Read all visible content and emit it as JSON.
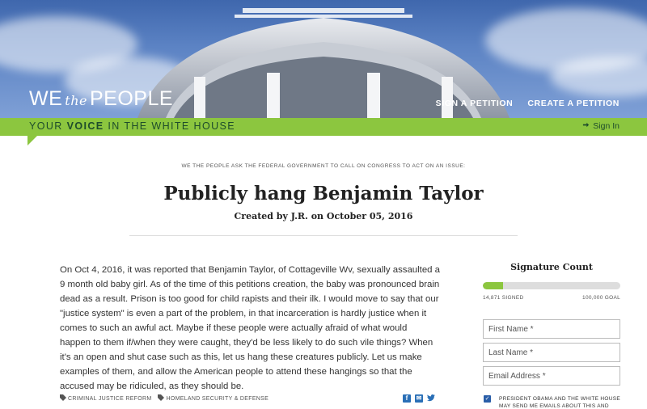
{
  "header": {
    "logo_we": "WE",
    "logo_the": "the",
    "logo_people": "PEOPLE",
    "nav": [
      {
        "label": "SIGN A PETITION"
      },
      {
        "label": "CREATE A PETITION"
      }
    ],
    "tagline_pre": "YOUR ",
    "tagline_bold": "VOICE",
    "tagline_post": " IN THE WHITE HOUSE",
    "signin_icon": "sign-in-icon",
    "signin_label": "Sign In",
    "colors": {
      "accent_green": "#8cc63f",
      "dark_green": "#1e4d2b",
      "link_blue": "#2a6fb6"
    }
  },
  "petition": {
    "intro": "WE THE PEOPLE ASK THE FEDERAL GOVERNMENT TO CALL ON CONGRESS TO ACT ON AN ISSUE:",
    "title": "Publicly hang Benjamin Taylor",
    "created": "Created by J.R. on October 05, 2016",
    "body": "On Oct 4, 2016, it was reported that Benjamin Taylor, of Cottageville Wv, sexually assaulted a 9 month old baby girl. As of the time of this petitions creation, the baby was pronounced brain dead as a result. Prison is too good for child rapists and their ilk. I would move to say that our \"justice system\" is even a part of the problem, in that incarceration is hardly justice when it comes to such an awful act. Maybe if these people were actually afraid of what would happen to them if/when they were caught, they'd be less likely to do such vile things? When it's an open and shut case such as this, let us hang these creatures publicly. Let us make examples of them, and allow the American people to attend these hangings so that the accused may be ridiculed, as they should be.",
    "tags": [
      {
        "icon": "tag-icon",
        "label": "CRIMINAL JUSTICE REFORM"
      },
      {
        "icon": "tag-icon",
        "label": "HOMELAND SECURITY & DEFENSE"
      }
    ],
    "share_icons": [
      "facebook-icon",
      "email-icon",
      "twitter-icon"
    ]
  },
  "sidebar": {
    "title": "Signature Count",
    "signed": "14,871 SIGNED",
    "goal": "100,000 GOAL",
    "progress_fraction": 0.1487,
    "first_name_placeholder": "First Name *",
    "last_name_placeholder": "Last Name *",
    "email_placeholder": "Email Address *",
    "opt_in_checked": true,
    "opt_in_label": "PRESIDENT OBAMA AND THE WHITE HOUSE MAY SEND ME EMAILS ABOUT THIS AND OTHER"
  }
}
